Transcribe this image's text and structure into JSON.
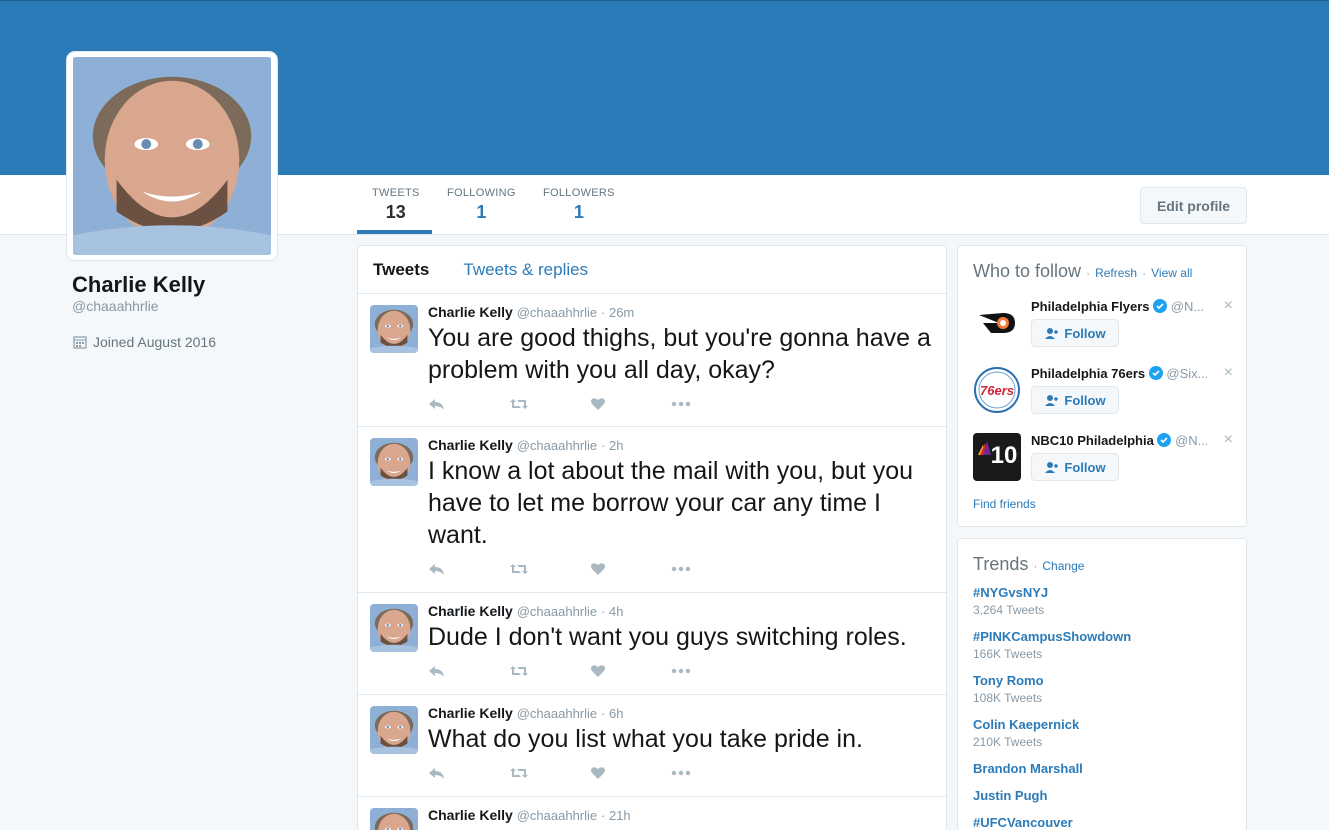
{
  "profile": {
    "name": "Charlie Kelly",
    "handle": "@chaaahhrlie",
    "joined": "Joined August 2016",
    "stats": [
      {
        "label": "TWEETS",
        "value": "13"
      },
      {
        "label": "FOLLOWING",
        "value": "1"
      },
      {
        "label": "FOLLOWERS",
        "value": "1"
      }
    ],
    "edit_label": "Edit profile"
  },
  "timeline": {
    "tabs": [
      "Tweets",
      "Tweets & replies"
    ],
    "tweets": [
      {
        "name": "Charlie Kelly",
        "handle": "@chaaahhrlie",
        "time": "· 26m",
        "text": "You are good thighs, but you're gonna have a problem with you all day, okay?"
      },
      {
        "name": "Charlie Kelly",
        "handle": "@chaaahhrlie",
        "time": "· 2h",
        "text": "I know a lot about the mail with you, but you have to let me borrow your car any time I want."
      },
      {
        "name": "Charlie Kelly",
        "handle": "@chaaahhrlie",
        "time": "· 4h",
        "text": "Dude I don't want you guys switching roles."
      },
      {
        "name": "Charlie Kelly",
        "handle": "@chaaahhrlie",
        "time": "· 6h",
        "text": "What do you list what you take pride in."
      },
      {
        "name": "Charlie Kelly",
        "handle": "@chaaahhrlie",
        "time": "· 21h",
        "text": ""
      }
    ]
  },
  "who_to_follow": {
    "title": "Who to follow",
    "refresh": "Refresh",
    "view_all": "View all",
    "dot": "·",
    "follow_label": "Follow",
    "close": "×",
    "suggestions": [
      {
        "name": "Philadelphia Flyers",
        "handle": "@N..."
      },
      {
        "name": "Philadelphia 76ers",
        "handle": "@Six..."
      },
      {
        "name": "NBC10 Philadelphia",
        "handle": "@N..."
      }
    ],
    "find_friends": "Find friends"
  },
  "trends": {
    "title": "Trends",
    "change": "Change",
    "dot": "·",
    "items": [
      {
        "name": "#NYGvsNYJ",
        "count": "3,264 Tweets"
      },
      {
        "name": "#PINKCampusShowdown",
        "count": "166K Tweets"
      },
      {
        "name": "Tony Romo",
        "count": "108K Tweets"
      },
      {
        "name": "Colin Kaepernick",
        "count": "210K Tweets"
      },
      {
        "name": "Brandon Marshall",
        "count": ""
      },
      {
        "name": "Justin Pugh",
        "count": ""
      },
      {
        "name": "#UFCVancouver",
        "count": ""
      }
    ]
  },
  "logos": {
    "nbc_text": "10",
    "sixers_text": "76ers"
  },
  "colors": {
    "banner": "#2b7bb9",
    "link": "#2b7bb9",
    "verified": "#1da1f2"
  }
}
